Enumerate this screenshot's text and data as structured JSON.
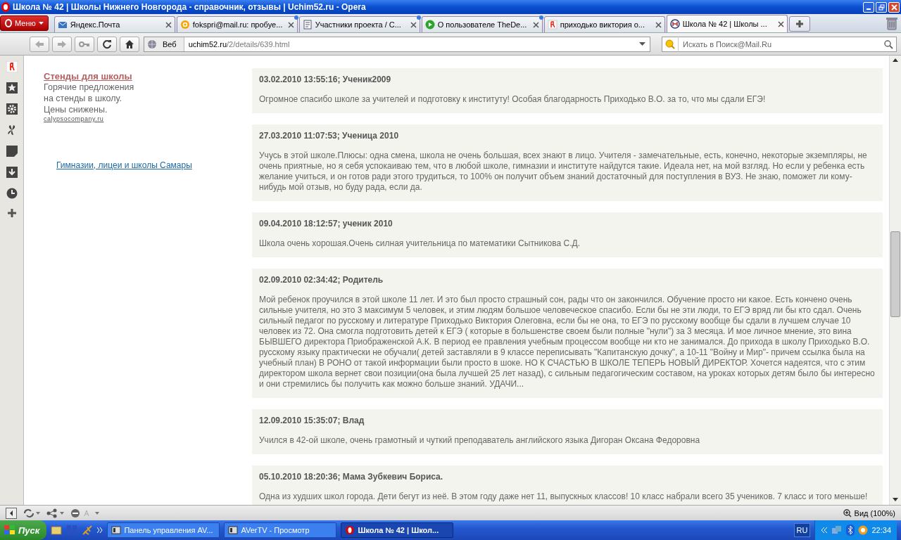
{
  "window": {
    "title": "Школа № 42 | Школы Нижнего Новгорода - справочник, отзывы | Uchim52.ru - Opera"
  },
  "menu_button": {
    "label": "Меню"
  },
  "tabs": [
    {
      "label": "Яндекс.Почта",
      "kind": "mail",
      "unread": false,
      "selected": false
    },
    {
      "label": "fokspri@mail.ru: пробуе...",
      "kind": "at",
      "unread": true,
      "selected": false
    },
    {
      "label": "Участники проекта / С...",
      "kind": "doc",
      "unread": true,
      "selected": false
    },
    {
      "label": "О пользователе TheDe...",
      "kind": "play",
      "unread": true,
      "selected": false
    },
    {
      "label": "приходько виктория о...",
      "kind": "yandex",
      "unread": false,
      "selected": false
    },
    {
      "label": "Школа № 42 | Школы ...",
      "kind": "site",
      "unread": false,
      "selected": true
    }
  ],
  "address_bar": {
    "search_engine": "Веб",
    "url_host": "uchim52.ru",
    "url_path": "/2/details/639.html"
  },
  "search": {
    "placeholder": "Искать в Поиск@Mail.Ru"
  },
  "ad": {
    "title": "Стенды для школы",
    "lines": [
      "Горячие предложения",
      "на стенды в школу.",
      "Цены снижены."
    ],
    "domain": "calypsocompany.ru"
  },
  "side_link": "Гимназии, лицеи и школы Самары",
  "comments": [
    {
      "header": "03.02.2010 13:55:16; Ученик2009",
      "text": "Огромное спасибо школе за учителей и подготовку к институту! Особая благодарность Приходько В.О. за то, что мы сдали ЕГЭ!"
    },
    {
      "header": "27.03.2010 11:07:53; Ученица 2010",
      "text": "Учусь в этой школе.Плюсы: одна смена, школа не очень большая, всех знают в лицо. Учителя - замечательные, есть, конечно, некоторые экземпляры, не очень приятные, но я себя успокаиваю тем, что в любой школе, гимназии и институте найдутся такие. Идеала нет, на мой взгляд. Но если у ребенка есть желание учиться, и он готов ради этого трудиться, то 100% он получит объем знаний достаточный для поступления в ВУЗ. Не знаю, поможет ли кому-нибудь мой отзыв, но буду рада, если да."
    },
    {
      "header": "09.04.2010 18:12:57; ученик 2010",
      "text": "Школа очень хорошая.Очень силная учительница по математики Сытникова С.Д."
    },
    {
      "header": "02.09.2010 02:34:42; Родитель",
      "text": "Мой ребенок проучился в этой школе 11 лет. И это был просто страшный сон, рады что он закончился. Обучение просто ни какое. Есть кончено очень сильные учителя, но это 3 максимум 5 человек, и этим людям большое человеческое спасибо. Если бы не эти люди, то ЕГЭ вряд ли бы кто сдал. Очень сильный педагог по русскому и литературе Приходько Виктория Олеговна, если бы не она, то ЕГЭ по русскому вообще бы сдали в лучшем случае 10 человек из 72. Она смогла подготовить детей к ЕГЭ ( которые в большенстве своем были полные \"нули\") за 3 месяца. И мое личное мнение, это вина БЫВШЕГО директора Приображенской А.К. В период ее правления учебным процессом вообще ни кто не занимался. До прихода в школу Приходько В.О. русскому языку практически не обучали( детей заставляли в 9 классе переписывать \"Капитанскую дочку\", а 10-11 \"Войну и Мир\"- причем ссылка была на учебный план) В РОНО от такой информации были просто в шоке. НО К СЧАСТЬЮ В ШКОЛЕ ТЕПЕРЬ НОВЫЙ ДИРЕКТОР. Хочется надеятся, что с этим директором школа вернет свои позиции(она была лучшей 25 лет назад), с сильным педагогическим составом, на уроках которых детям было бы интересно и они стремились бы получить как можно больше знаний. УДАЧИ..."
    },
    {
      "header": "12.09.2010 15:35:07; Влад",
      "text": "Учился в 42-ой школе, очень грамотный и чуткий преподаватель английского языка Дигоран Оксана Федоровна"
    },
    {
      "header": "05.10.2010 18:20:36; Мама Зубкевич Бориса.",
      "text": "Одна из худших школ города. Дети бегут из неё. В этом году даже нет 11, выпускных классов! 10 класс набрали всего 35 учеников. 7 класс и того меньше!"
    }
  ],
  "status_bar": {
    "zoom": "Вид (100%)"
  },
  "taskbar": {
    "start": "Пуск",
    "tasks": [
      {
        "label": "Панель управления AV...",
        "selected": false
      },
      {
        "label": "AVerTV - Просмотр",
        "selected": false
      },
      {
        "label": "Школа № 42 | Школ...",
        "selected": true
      }
    ],
    "language": "RU",
    "clock": "22:34"
  }
}
